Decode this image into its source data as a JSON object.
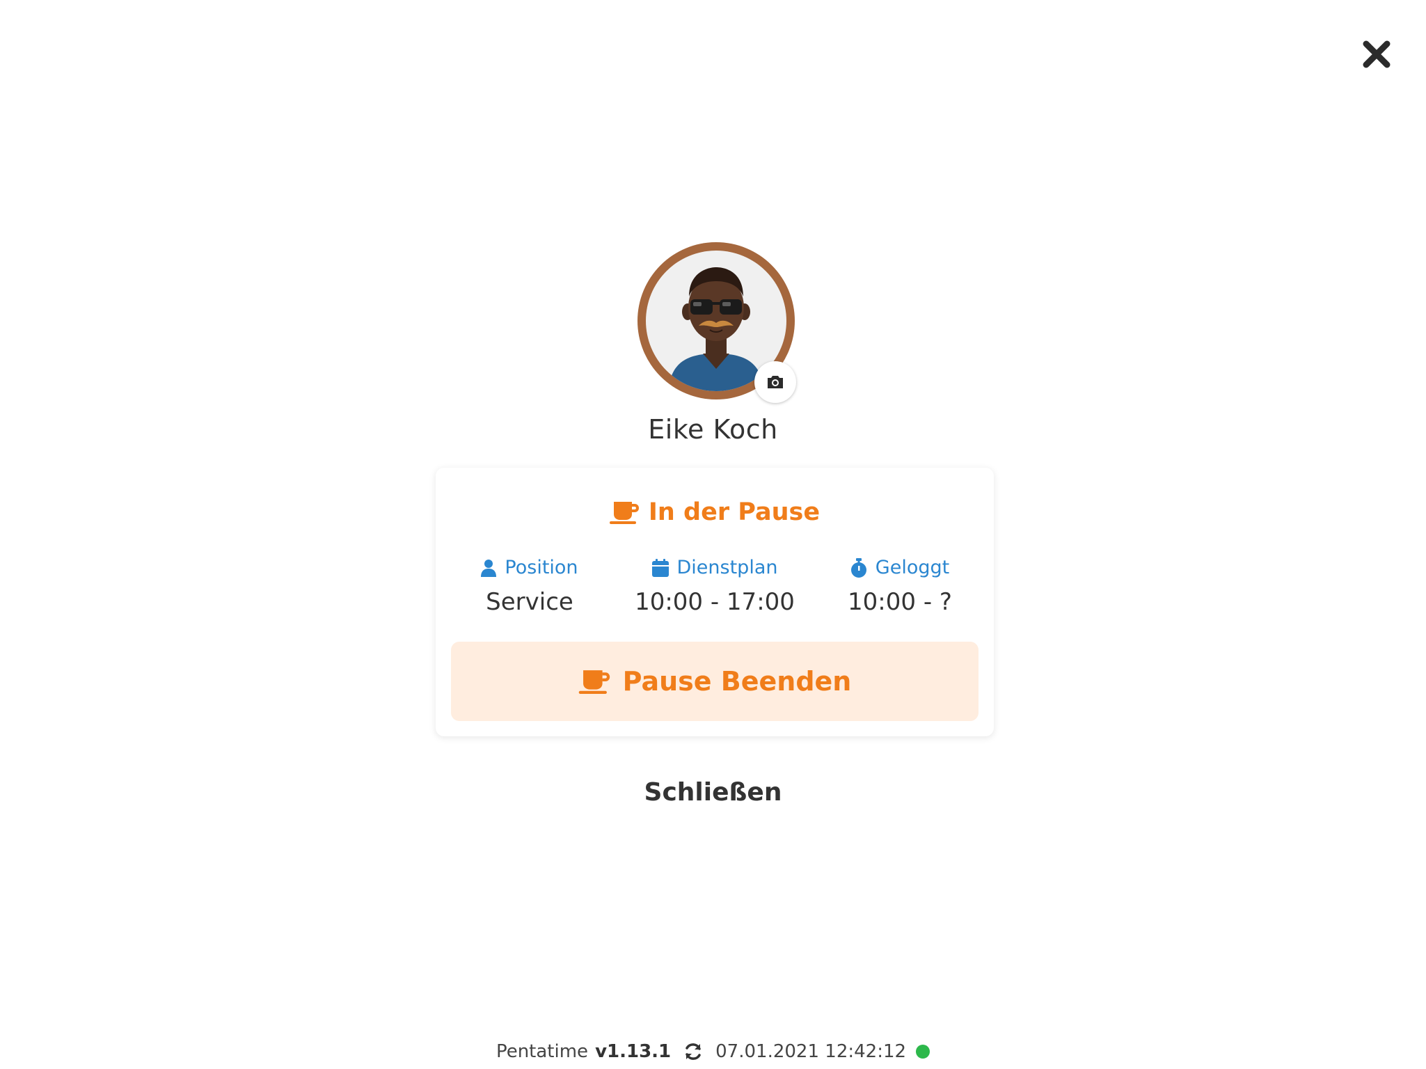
{
  "user": {
    "name": "Eike Koch"
  },
  "status": {
    "label": "In der Pause",
    "color": "#f07d1a"
  },
  "info": {
    "position": {
      "label": "Position",
      "value": "Service"
    },
    "schedule": {
      "label": "Dienstplan",
      "value": "10:00 - 17:00"
    },
    "logged": {
      "label": "Geloggt",
      "value": "10:00 - ?"
    }
  },
  "actions": {
    "end_pause_label": "Pause Beenden",
    "close_label": "Schließen"
  },
  "footer": {
    "app_name": "Pentatime",
    "version": "v1.13.1",
    "datetime": "07.01.2021 12:42:12",
    "connection_color": "#2db84b"
  },
  "icons": {
    "close": "close-icon",
    "camera": "camera-icon",
    "coffee": "coffee-icon",
    "user": "user-icon",
    "calendar": "calendar-icon",
    "stopwatch": "stopwatch-icon",
    "refresh": "refresh-icon"
  },
  "colors": {
    "accent_orange": "#f07d1a",
    "accent_blue": "#2a86d0",
    "avatar_ring": "#a5673d",
    "pause_button_bg": "#ffeddf"
  }
}
